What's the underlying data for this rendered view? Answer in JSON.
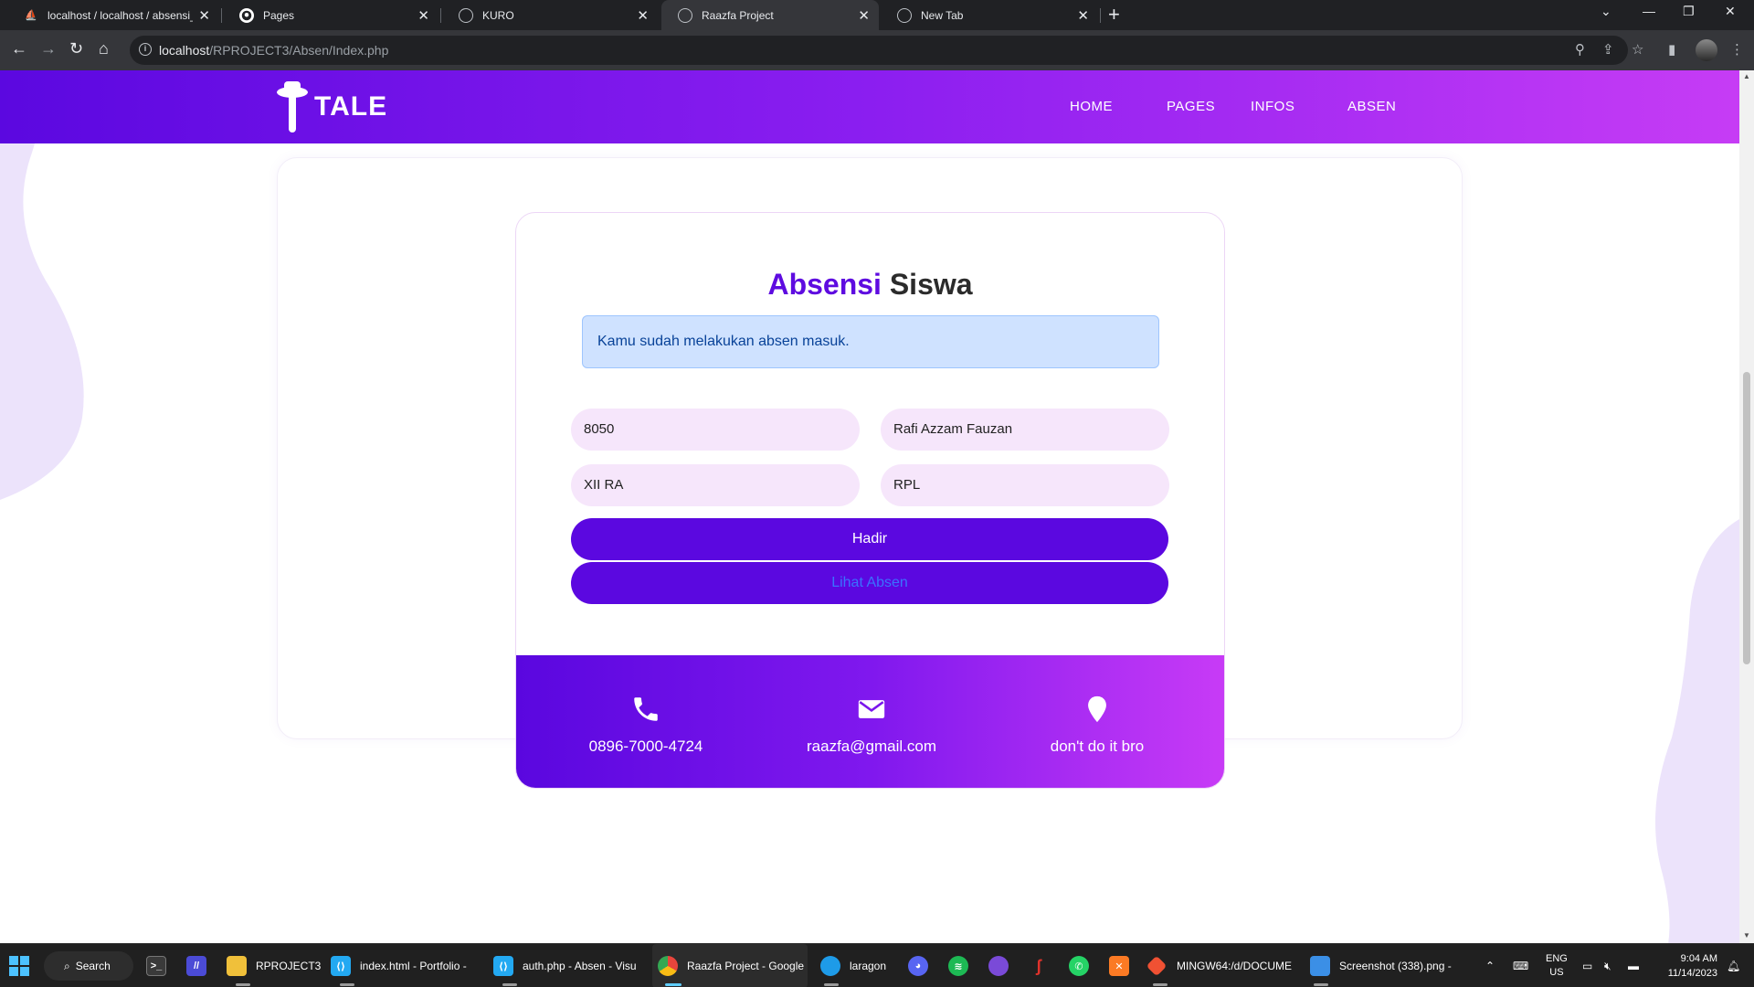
{
  "browser": {
    "tabs": [
      {
        "title": "localhost / localhost / absensi_k",
        "favicon": "phpmyadmin-icon",
        "color": "#f5a623",
        "active": false
      },
      {
        "title": "Pages",
        "favicon": "github-icon",
        "color": "#ffffff",
        "active": false
      },
      {
        "title": "KURO",
        "favicon": "globe-icon",
        "color": "#bdc1c6",
        "active": false
      },
      {
        "title": "Raazfa Project",
        "favicon": "globe-icon",
        "color": "#bdc1c6",
        "active": true
      },
      {
        "title": "New Tab",
        "favicon": "chrome-icon",
        "color": "#bdc1c6",
        "active": false
      }
    ],
    "url_host": "localhost",
    "url_path": "/RPROJECT3/Absen/Index.php"
  },
  "site": {
    "brand": "TALE",
    "nav": [
      "HOME",
      "PAGES",
      "INFOS",
      "ABSEN"
    ],
    "accent_color": "#5b08e0",
    "gradient_end": "#c63cf5"
  },
  "form": {
    "title_accent": "Absensi",
    "title_rest": "Siswa",
    "alert": "Kamu sudah melakukan absen masuk.",
    "fields": {
      "nis": "8050",
      "nama": "Rafi Azzam Fauzan",
      "kelas": "XII RA",
      "jurusan": "RPL"
    },
    "submit_label": "Hadir",
    "view_label": "Lihat Absen"
  },
  "contact": {
    "phone": "0896-7000-4724",
    "email": "raazfa@gmail.com",
    "location": "don't do it bro"
  },
  "taskbar": {
    "search_label": "Search",
    "apps": [
      {
        "label": "RPROJECT3",
        "icon": "folder-icon",
        "color": "#f0c03a"
      },
      {
        "label": "index.html - Portfolio - ",
        "icon": "vscode-icon",
        "color": "#23a9f2"
      },
      {
        "label": "auth.php - Absen - Visu",
        "icon": "vscode-icon",
        "color": "#23a9f2"
      },
      {
        "label": "Raazfa Project - Google",
        "icon": "chrome-icon",
        "color": "#e8453c"
      },
      {
        "label": "laragon",
        "icon": "laragon-icon",
        "color": "#1e9be8"
      },
      {
        "label": "MINGW64:/d/DOCUME",
        "icon": "git-icon",
        "color": "#f05133"
      },
      {
        "label": "Screenshot (338).png -",
        "icon": "paint-icon",
        "color": "#3b8fe6"
      }
    ],
    "tray_lang_1": "ENG",
    "tray_lang_2": "US",
    "time": "9:04 AM",
    "date": "11/14/2023"
  }
}
